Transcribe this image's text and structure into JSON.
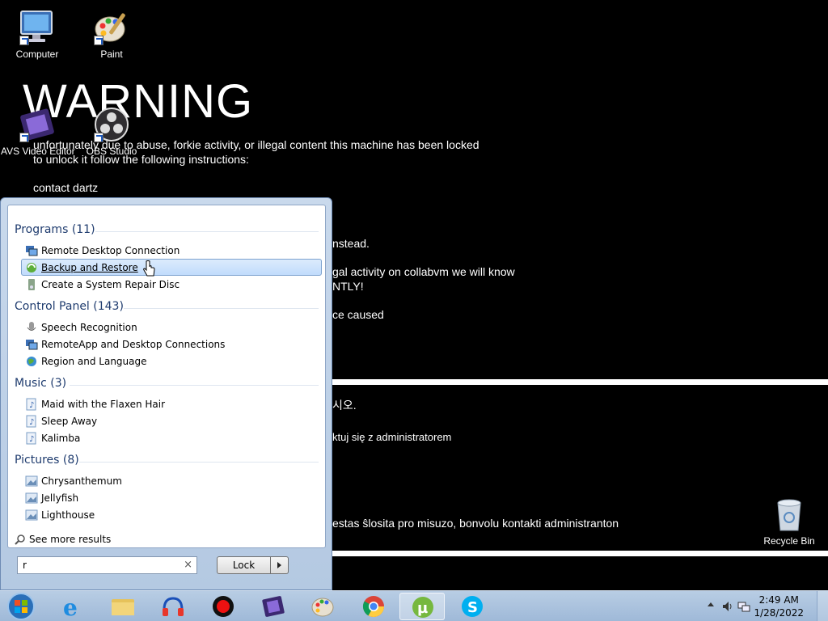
{
  "wallpaper": {
    "title": "WARNING",
    "lines": [
      "unfortunately due to abuse, forkie activity, or illegal content this machine has been locked",
      "to unlock it follow the following instructions:",
      "contact dartz",
      "nstead.",
      "gal activity on collabvm we will know",
      "NTLY!",
      "ce caused",
      "시오.",
      "ktuj się z administratorem",
      "estas ŝlosita pro misuzo, bonvolu kontakti administranton"
    ]
  },
  "desktop": {
    "icons": [
      {
        "label": "Computer"
      },
      {
        "label": "Paint"
      },
      {
        "label": "AVS Video Editor"
      },
      {
        "label": "OBS Studio"
      },
      {
        "label": "Recycle Bin"
      }
    ]
  },
  "start_menu": {
    "categories": [
      {
        "label": "Programs (11)",
        "items": [
          "Remote Desktop Connection",
          "Backup and Restore",
          "Create a System Repair Disc"
        ]
      },
      {
        "label": "Control Panel (143)",
        "items": [
          "Speech Recognition",
          "RemoteApp and Desktop Connections",
          "Region and Language"
        ]
      },
      {
        "label": "Music (3)",
        "items": [
          "Maid with the Flaxen Hair",
          "Sleep Away",
          "Kalimba"
        ]
      },
      {
        "label": "Pictures (8)",
        "items": [
          "Chrysanthemum",
          "Jellyfish",
          "Lighthouse"
        ]
      }
    ],
    "see_more": "See more results",
    "search_value": "r",
    "clear_glyph": "×",
    "lock_label": "Lock"
  },
  "taskbar": {
    "time": "2:49 AM",
    "date": "1/28/2022"
  }
}
